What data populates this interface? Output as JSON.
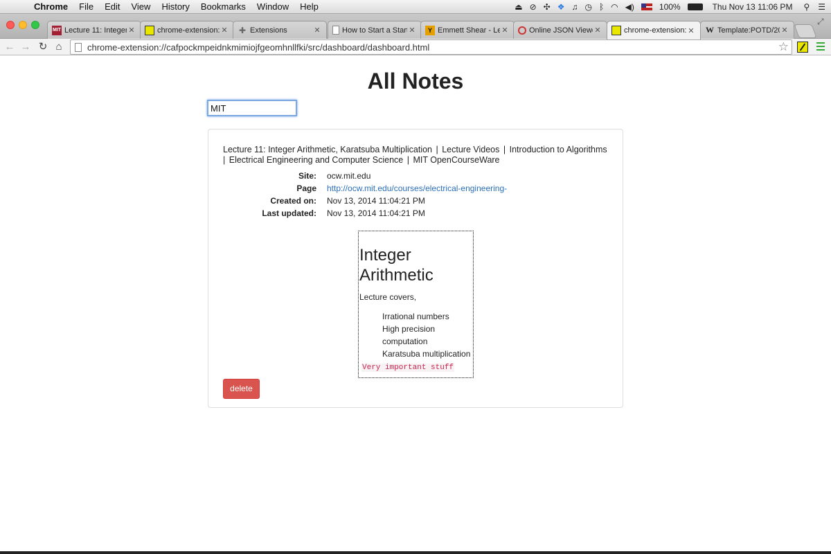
{
  "menubar": {
    "app_name": "Chrome",
    "menus": [
      "File",
      "Edit",
      "View",
      "History",
      "Bookmarks",
      "Window",
      "Help"
    ],
    "battery": "100%",
    "clock": "Thu Nov 13  11:06 PM"
  },
  "tabs": [
    {
      "title": "Lecture 11: Integer A",
      "favicon": "mit-icon",
      "active": false
    },
    {
      "title": "chrome-extension:/",
      "favicon": "extension-note-icon",
      "active": false
    },
    {
      "title": "Extensions",
      "favicon": "puzzle-icon",
      "active": false
    },
    {
      "title": "How to Start a Startu",
      "favicon": "document-icon",
      "active": false
    },
    {
      "title": "Emmett Shear - Lect",
      "favicon": "ye-icon",
      "active": false
    },
    {
      "title": "Online JSON Viewer",
      "favicon": "ring-icon",
      "active": false
    },
    {
      "title": "chrome-extension:/",
      "favicon": "extension-note-icon",
      "active": true
    },
    {
      "title": "Template:POTD/201",
      "favicon": "wikipedia-icon",
      "active": false
    }
  ],
  "toolbar": {
    "url": "chrome-extension://cafpockmpeidnkmimiojfgeomhnllfki/src/dashboard/dashboard.html"
  },
  "page": {
    "title": "All Notes",
    "search_value": "MIT"
  },
  "note": {
    "title_parts": [
      "Lecture 11: Integer Arithmetic, Karatsuba Multiplication",
      "Lecture Videos",
      "Introduction to Algorithms",
      "Electrical Engineering and Computer Science",
      "MIT OpenCourseWare"
    ],
    "meta": {
      "site_label": "Site:",
      "site_value": "ocw.mit.edu",
      "page_label": "Page",
      "page_value": "http://ocw.mit.edu/courses/electrical-engineering-",
      "created_label": "Created on:",
      "created_value": "Nov 13, 2014 11:04:21 PM",
      "updated_label": "Last updated:",
      "updated_value": "Nov 13, 2014 11:04:21 PM"
    },
    "body": {
      "heading": "Integer Arithmetic",
      "intro": "Lecture covers,",
      "items": [
        "Irrational numbers",
        "High precision computation",
        "Karatsuba multiplication"
      ],
      "code": "Very important stuff"
    },
    "delete_label": "delete"
  },
  "colors": {
    "delete_button": "#d9534f",
    "link": "#2a6ebb",
    "code_text": "#c7254e",
    "focus_ring": "#7aa7e0"
  }
}
